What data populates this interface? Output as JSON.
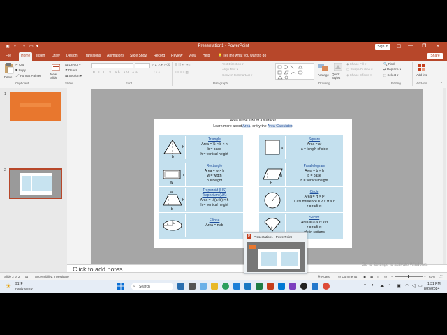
{
  "window": {
    "title": "Presentation1 - PowerPoint",
    "sign_in": "Sign in",
    "share": "Share"
  },
  "tabs": [
    "File",
    "Home",
    "Insert",
    "Draw",
    "Design",
    "Transitions",
    "Animations",
    "Slide Show",
    "Record",
    "Review",
    "View",
    "Help"
  ],
  "tell_me": "Tell me what you want to do",
  "ribbon": {
    "clipboard": {
      "paste": "Paste",
      "cut": "Cut",
      "copy": "Copy",
      "format_painter": "Format Painter",
      "label": "Clipboard"
    },
    "slides": {
      "new_slide": "New Slide",
      "layout": "Layout",
      "reset": "Reset",
      "section": "Section",
      "label": "Slides"
    },
    "font_label": "Font",
    "paragraph": {
      "text_direction": "Text Direction",
      "align_text": "Align Text",
      "smartart": "Convert to SmartArt",
      "label": "Paragraph"
    },
    "drawing": {
      "arrange": "Arrange",
      "quick_styles": "Quick Styles",
      "shape_fill": "Shape Fill",
      "shape_outline": "Shape Outline",
      "shape_effects": "Shape Effects",
      "label": "Drawing"
    },
    "editing": {
      "find": "Find",
      "replace": "Replace",
      "select": "Select",
      "label": "Editing"
    },
    "addins": {
      "addins": "Add-ins",
      "label": "Add-ins"
    }
  },
  "thumbnails": [
    {
      "number": "1"
    },
    {
      "number": "2"
    }
  ],
  "slide": {
    "heading": "Area is the size of a surface!",
    "learn_prefix": "Learn more about",
    "learn_link1": "Area",
    "learn_mid": ", or try the",
    "learn_link2": "Area Calculator",
    "learn_end": ".",
    "left_cells": [
      {
        "icon": "triangle-icon",
        "title": "Triangle",
        "lines": [
          "Area = ½ × b × h",
          "b = base",
          "h = vertical height"
        ]
      },
      {
        "icon": "rectangle-icon",
        "title": "Rectangle",
        "lines": [
          "Area = w × h",
          "w = width",
          "h = height"
        ]
      },
      {
        "icon": "trapezoid-icon",
        "title": "Trapezoid (US)",
        "title2": "Trapezium (UK)",
        "lines": [
          "Area = ½(a+b) × h",
          "h = vertical height"
        ]
      },
      {
        "icon": "ellipse-icon",
        "title": "Ellipse",
        "lines": [
          "Area = πab"
        ]
      }
    ],
    "right_cells": [
      {
        "icon": "square-icon",
        "title": "Square",
        "lines": [
          "Area = a²",
          "a = length of side"
        ]
      },
      {
        "icon": "parallelogram-icon",
        "title": "Parallelogram",
        "lines": [
          "Area = b × h",
          "b = base",
          "h = vertical height"
        ]
      },
      {
        "icon": "circle-icon",
        "title": "Circle",
        "lines": [
          "Area = π × r²",
          "Circumference = 2 × π × r",
          "r = radius"
        ]
      },
      {
        "icon": "sector-icon",
        "title": "Sector",
        "lines": [
          "Area = ½ × r² × θ",
          "r = radius",
          "gle in radians"
        ]
      }
    ]
  },
  "notes_placeholder": "Click to add notes",
  "status": {
    "slide_of": "Slide 2 of 2",
    "accessibility": "Accessibility: Investigate",
    "notes": "Notes",
    "comments": "Comments",
    "zoom": "63%"
  },
  "activation": "Go to Settings to activate Windows.",
  "taskbar": {
    "temperature": "91°F",
    "condition": "Partly sunny",
    "search": "Search",
    "time": "1:31 PM",
    "date": "8/20/2024"
  },
  "preview": {
    "title": "Presentation1 - PowerPoint"
  },
  "colors": {
    "accent": "#b7472a",
    "panel": "#c4e0ee",
    "link": "#1f4e9c"
  }
}
